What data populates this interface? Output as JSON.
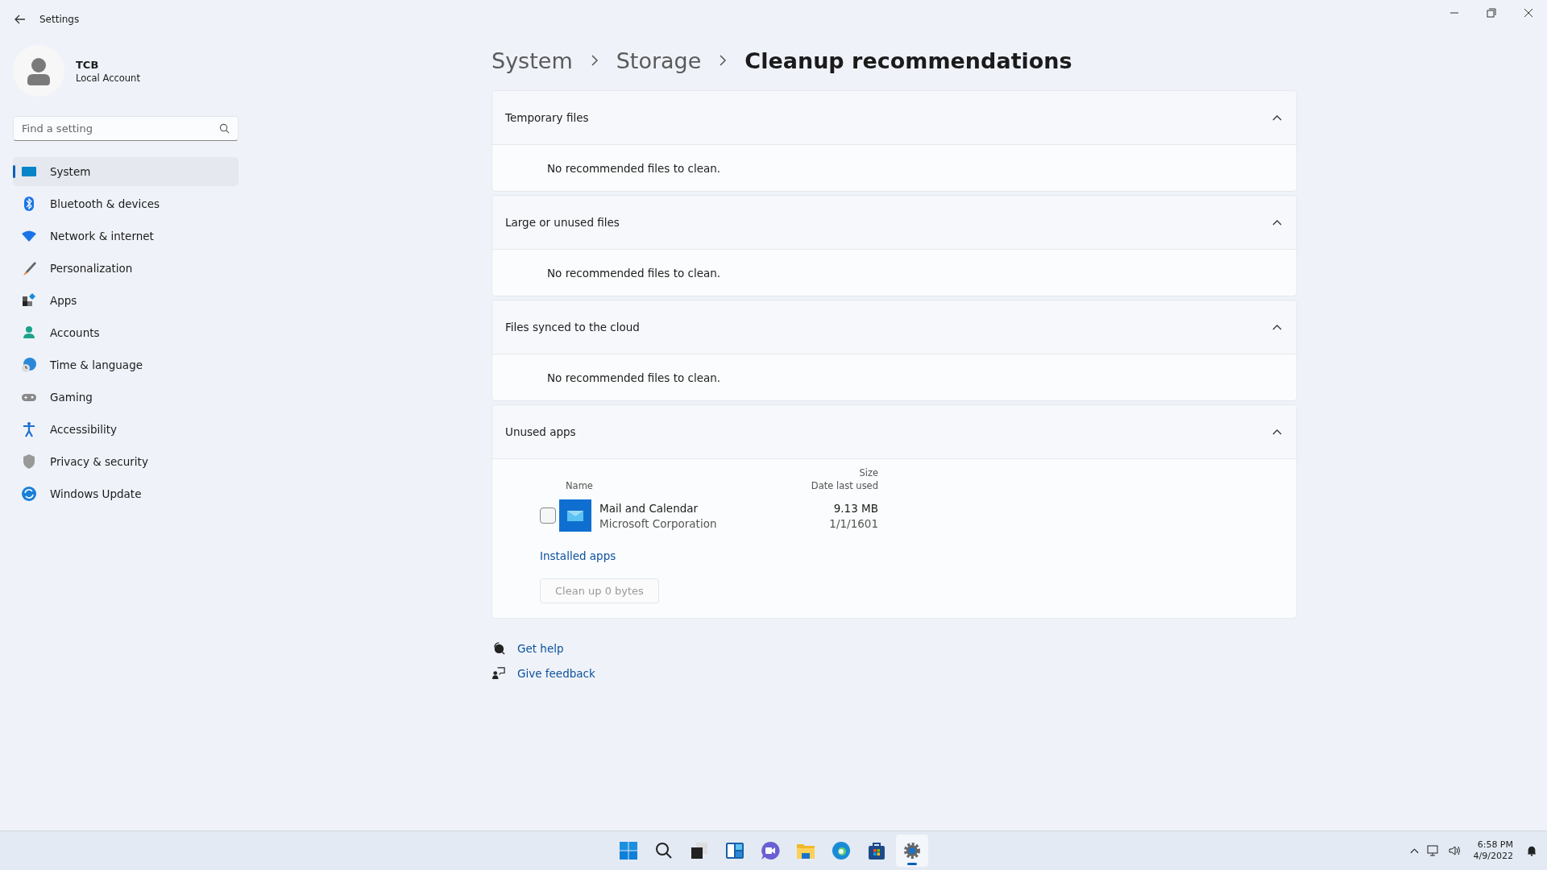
{
  "window": {
    "title": "Settings"
  },
  "account": {
    "name": "TCB",
    "type": "Local Account"
  },
  "search": {
    "placeholder": "Find a setting"
  },
  "sidebar": {
    "items": [
      {
        "label": "System",
        "selected": true
      },
      {
        "label": "Bluetooth & devices",
        "selected": false
      },
      {
        "label": "Network & internet",
        "selected": false
      },
      {
        "label": "Personalization",
        "selected": false
      },
      {
        "label": "Apps",
        "selected": false
      },
      {
        "label": "Accounts",
        "selected": false
      },
      {
        "label": "Time & language",
        "selected": false
      },
      {
        "label": "Gaming",
        "selected": false
      },
      {
        "label": "Accessibility",
        "selected": false
      },
      {
        "label": "Privacy & security",
        "selected": false
      },
      {
        "label": "Windows Update",
        "selected": false
      }
    ]
  },
  "breadcrumb": [
    "System",
    "Storage",
    "Cleanup recommendations"
  ],
  "sections": [
    {
      "title": "Temporary files",
      "expanded": true,
      "kind": "message",
      "message": "No recommended files to clean."
    },
    {
      "title": "Large or unused files",
      "expanded": true,
      "kind": "message",
      "message": "No recommended files to clean."
    },
    {
      "title": "Files synced to the cloud",
      "expanded": true,
      "kind": "message",
      "message": "No recommended files to clean."
    },
    {
      "title": "Unused apps",
      "expanded": true,
      "kind": "apps",
      "columns": {
        "name": "Name",
        "size": "Size",
        "date": "Date last used"
      },
      "apps": [
        {
          "name": "Mail and Calendar",
          "publisher": "Microsoft Corporation",
          "size": "9.13 MB",
          "date": "1/1/1601",
          "checked": false
        }
      ],
      "link": "Installed apps",
      "button": {
        "label": "Clean up 0 bytes",
        "disabled": true
      }
    }
  ],
  "help_links": [
    "Get help",
    "Give feedback"
  ],
  "taskbar": {
    "time": "6:58 PM",
    "date": "4/9/2022"
  }
}
